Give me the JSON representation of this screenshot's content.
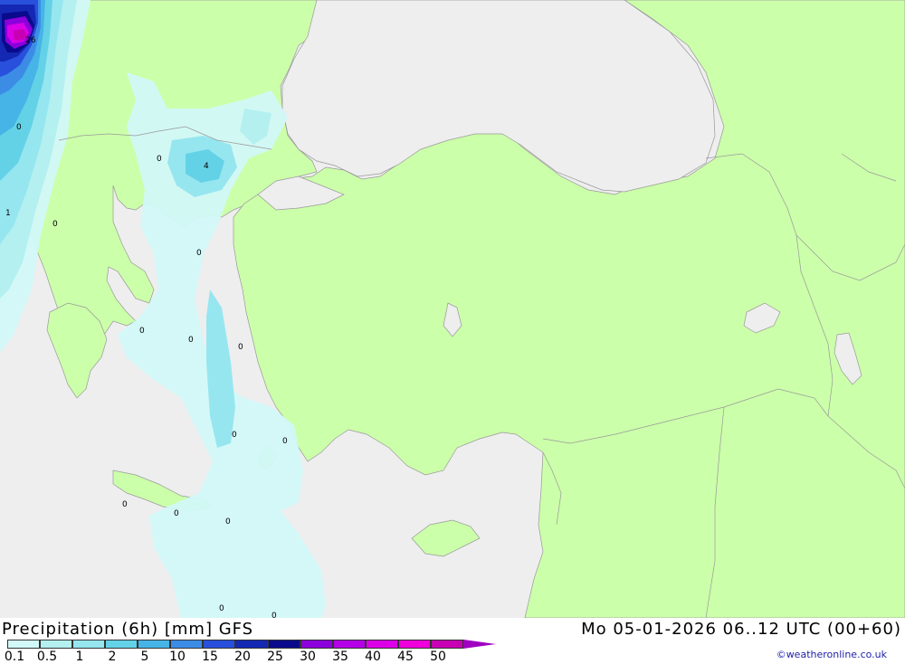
{
  "header": {
    "title": "Precipitation (6h) [mm] GFS",
    "datetime": "Mo 05-01-2026 06..12 UTC (00+60)",
    "credit": "©weatheronline.co.uk"
  },
  "legend": {
    "ticks": [
      "0.1",
      "0.5",
      "1",
      "2",
      "5",
      "10",
      "15",
      "20",
      "25",
      "30",
      "35",
      "40",
      "45",
      "50"
    ],
    "colors": [
      "#d2f8f8",
      "#b4f0f0",
      "#96e6f0",
      "#64d2e6",
      "#46b4e6",
      "#3c8ce6",
      "#2850dc",
      "#1428b4",
      "#0a0a8c",
      "#8c00dc",
      "#b400e6",
      "#dc00e6",
      "#f000dc",
      "#c800b4"
    ],
    "arrow_color": "#a000c0"
  },
  "map": {
    "land_color": "#ccffaa",
    "sea_color": "#eeeeee",
    "border_color": "#999999",
    "contour_labels": [
      "26",
      "0",
      "1",
      "0",
      "0",
      "4",
      "0",
      "0",
      "0",
      "0",
      "0",
      "0",
      "0",
      "0",
      "0",
      "0",
      "0"
    ]
  }
}
